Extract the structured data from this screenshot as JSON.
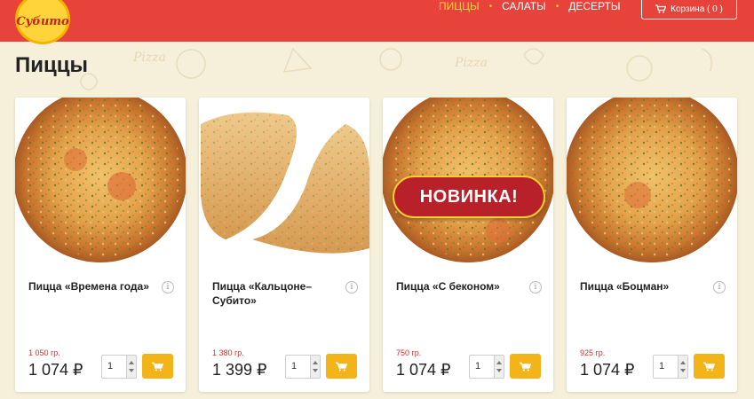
{
  "header": {
    "logo_text": "Субито",
    "nav": [
      {
        "label": "ПИЦЦЫ",
        "active": true
      },
      {
        "label": "САЛАТЫ",
        "active": false
      },
      {
        "label": "ДЕСЕРТЫ",
        "active": false
      }
    ],
    "cart_label": "Корзина ( 0 )",
    "accent_color": "#e8433b",
    "highlight_color": "#ffd43a"
  },
  "page": {
    "title": "Пиццы"
  },
  "products": [
    {
      "name": "Пицца «Времена года»",
      "weight": "1 050 гр.",
      "price": "1 074 ₽",
      "quantity": "1",
      "badge": "",
      "photo_icon": "round-pizza-photo"
    },
    {
      "name": "Пицца «Кальцоне–Субито»",
      "weight": "1 380 гр.",
      "price": "1 399 ₽",
      "quantity": "1",
      "badge": "",
      "photo_icon": "calzone-photo"
    },
    {
      "name": "Пицца «С беконом»",
      "weight": "750 гр.",
      "price": "1 074 ₽",
      "quantity": "1",
      "badge": "НОВИНКА!",
      "photo_icon": "round-pizza-photo"
    },
    {
      "name": "Пицца «Боцман»",
      "weight": "925 гр.",
      "price": "1 074 ₽",
      "quantity": "1",
      "badge": "",
      "photo_icon": "round-pizza-photo"
    }
  ]
}
